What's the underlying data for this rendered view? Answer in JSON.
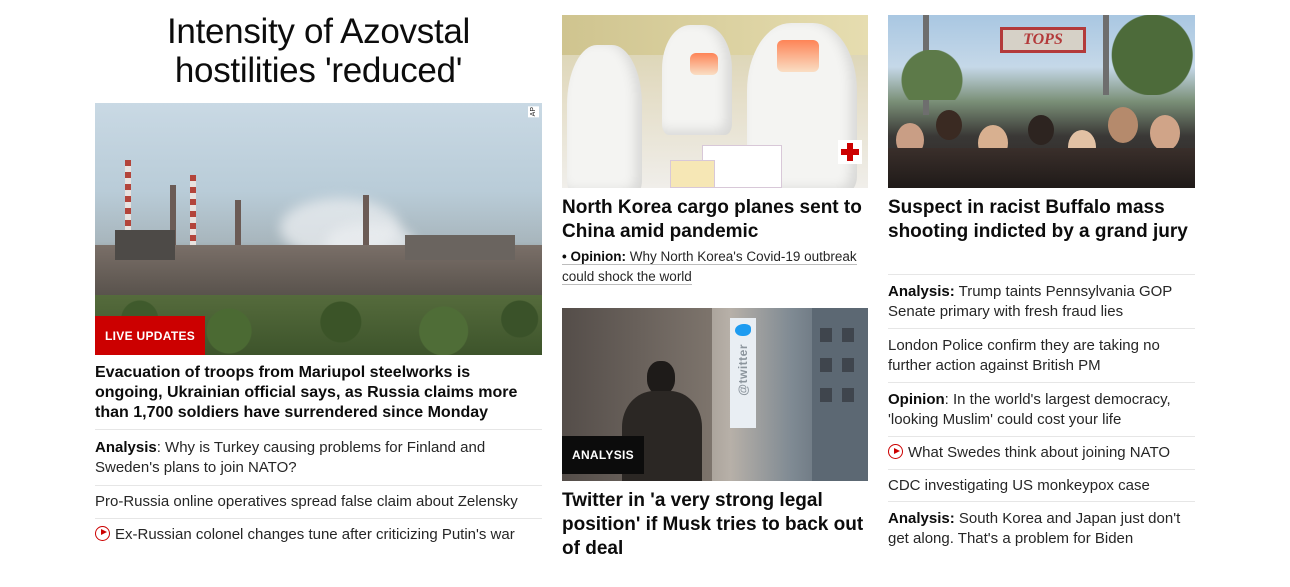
{
  "lead": {
    "title": "Intensity of Azovstal hostilities 'reduced'",
    "image_credit": "AP",
    "badge": "LIVE UPDATES",
    "headline": "Evacuation of troops from Mariupol steelworks is ongoing, Ukrainian official says, as Russia claims more than 1,700 soldiers have surrendered since Monday",
    "links": [
      {
        "prefix": "Analysis",
        "text": ": Why is Turkey causing problems for Finland and Sweden's plans to join NATO?"
      },
      {
        "prefix": "",
        "text": "Pro-Russia online operatives spread false claim about Zelensky"
      },
      {
        "prefix": "",
        "text": "Ex-Russian colonel changes tune after criticizing Putin's war",
        "icon": "play-icon"
      }
    ]
  },
  "middle": {
    "north_korea": {
      "headline": "North Korea cargo planes sent to China amid pandemic",
      "opinion_label": "Opinion:",
      "opinion_text": "Why North Korea's Covid-19 outbreak could shock the world"
    },
    "twitter": {
      "badge": "ANALYSIS",
      "headline": "Twitter in 'a very strong legal position' if Musk tries to back out of deal",
      "banner_text": "@twitter"
    }
  },
  "right": {
    "headline": "Suspect in racist Buffalo mass shooting indicted by a grand jury",
    "sign_text": "TOPS",
    "links": [
      {
        "prefix": "Analysis:",
        "text": " Trump taints Pennsylvania GOP Senate primary with fresh fraud lies"
      },
      {
        "prefix": "",
        "text": "London Police confirm they are taking no further action against British PM"
      },
      {
        "prefix": "Opinion",
        "text": ": In the world's largest democracy, 'looking Muslim' could cost your life"
      },
      {
        "prefix": "",
        "text": "What Swedes think about joining NATO",
        "icon": "play-icon"
      },
      {
        "prefix": "",
        "text": "CDC investigating US monkeypox case"
      },
      {
        "prefix": "Analysis:",
        "text": " South Korea and Japan just don't get along. That's a problem for Biden"
      }
    ]
  },
  "colors": {
    "accent_red": "#cc0000",
    "badge_black": "#0c0c0c",
    "divider": "#e6e6e6"
  }
}
